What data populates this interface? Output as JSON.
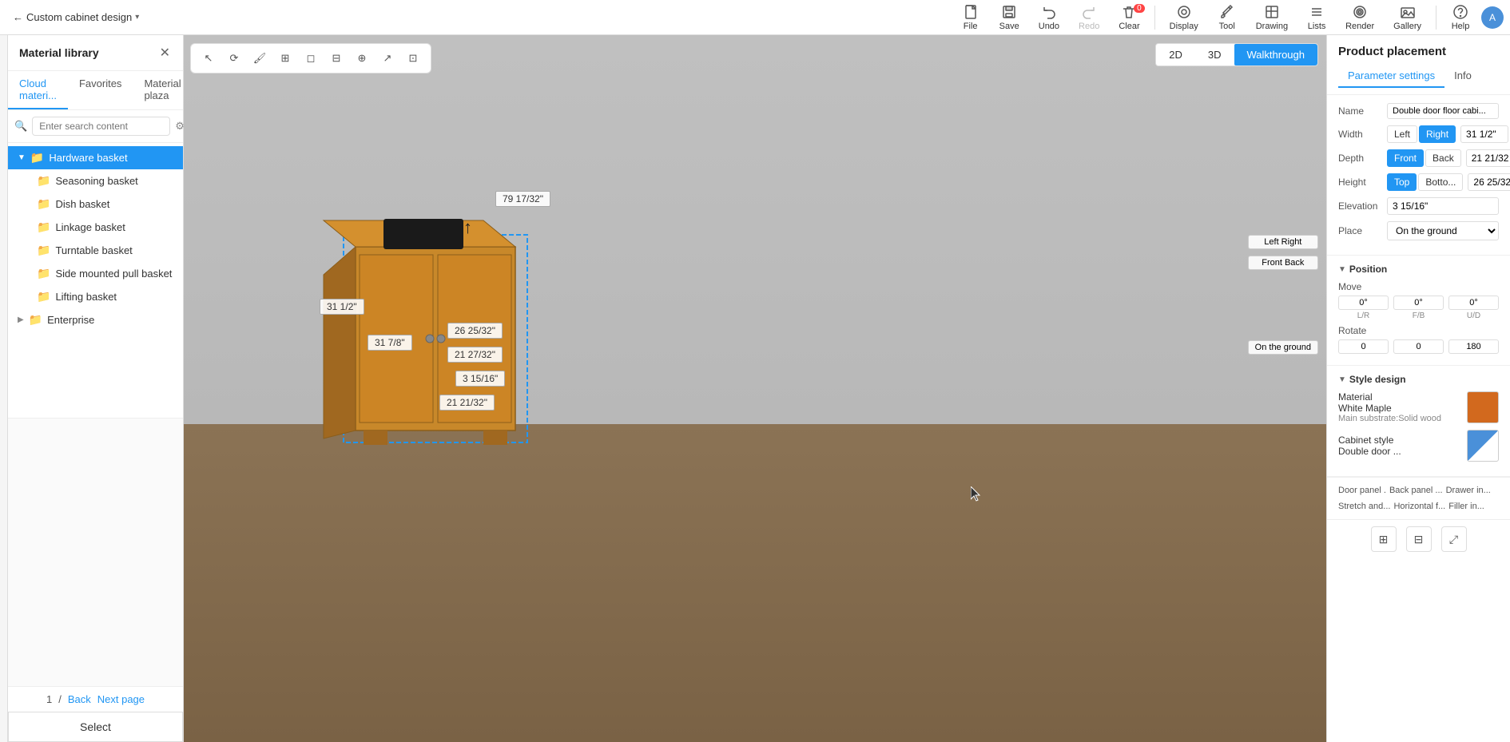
{
  "app": {
    "title": "Custom cabinet design",
    "back_arrow": "←"
  },
  "toolbar": {
    "file_label": "File",
    "save_label": "Save",
    "undo_label": "Undo",
    "redo_label": "Redo",
    "clear_label": "Clear",
    "display_label": "Display",
    "tool_label": "Tool",
    "drawing_label": "Drawing",
    "lists_label": "Lists",
    "render_label": "Render",
    "gallery_label": "Gallery",
    "help_label": "Help",
    "clear_badge": "0",
    "clear_badge_label": "Clear"
  },
  "view_mode": {
    "btn_2d": "2D",
    "btn_3d": "3D",
    "btn_walkthrough": "Walkthrough"
  },
  "material_library": {
    "title": "Material library",
    "tabs": [
      "Cloud materi...",
      "Favorites",
      "Material plaza"
    ],
    "search_placeholder": "Enter search content",
    "active_tab": "Cloud materi...",
    "tree": {
      "hardware_basket": "Hardware basket",
      "items": [
        {
          "label": "Seasoning basket",
          "indent": true
        },
        {
          "label": "Dish basket",
          "indent": true
        },
        {
          "label": "Linkage basket",
          "indent": true
        },
        {
          "label": "Turntable basket",
          "indent": true
        },
        {
          "label": "Side mounted pull basket",
          "indent": true
        },
        {
          "label": "Lifting basket",
          "indent": true
        },
        {
          "label": "Enterprise",
          "indent": false,
          "expandable": true
        }
      ]
    },
    "pagination": {
      "current": "1",
      "separator": "/",
      "back": "Back",
      "next": "Next page"
    },
    "select_btn": "Select"
  },
  "viewport": {
    "dimensions": {
      "top": "79 17/32\"",
      "width_top": "31 1/2\"",
      "width_left": "31 7/8\"",
      "depth1": "26 25/32\"",
      "depth2": "21 27/32\"",
      "elevation": "3 15/16\"",
      "depth3": "21 21/32\""
    },
    "controls": {
      "left_right": "Left Right",
      "front_back": "Front Back",
      "on_ground": "On the ground"
    }
  },
  "right_panel": {
    "title": "Product placement",
    "tabs": [
      "Parameter settings",
      "Info"
    ],
    "active_tab": "Parameter settings",
    "name_label": "Name",
    "name_value": "Double door floor cabi...",
    "width_label": "Width",
    "width_left": "Left",
    "width_right": "Right",
    "width_value": "31 1/2\"",
    "depth_label": "Depth",
    "depth_front": "Front",
    "depth_back": "Back",
    "depth_value": "21 21/32\"",
    "height_label": "Height",
    "height_top": "Top",
    "height_bottom": "Botto...",
    "height_value": "26 25/32\"",
    "elevation_label": "Elevation",
    "elevation_value": "3 15/16\"",
    "place_label": "Place",
    "place_value": "On the ground",
    "position_section": "Position",
    "move_label": "Move",
    "move_lr": "0°",
    "move_fb": "0°",
    "move_ud": "0°",
    "move_lr_label": "L/R",
    "move_fb_label": "F/B",
    "move_ud_label": "U/D",
    "rotate_label": "Rotate",
    "rotate_x": "0",
    "rotate_y": "0",
    "rotate_z": "180",
    "style_design": "Style design",
    "material_label": "Material",
    "material_name": "White Maple",
    "material_sub": "Main substrate:Solid wood",
    "cabinet_style_label": "Cabinet style",
    "cabinet_style_name": "Double door ...",
    "bottom_tags": [
      "Door panel .",
      "Back panel ...",
      "Drawer in...",
      "Stretch and...",
      "Horizontal f...",
      "Filler in..."
    ]
  }
}
